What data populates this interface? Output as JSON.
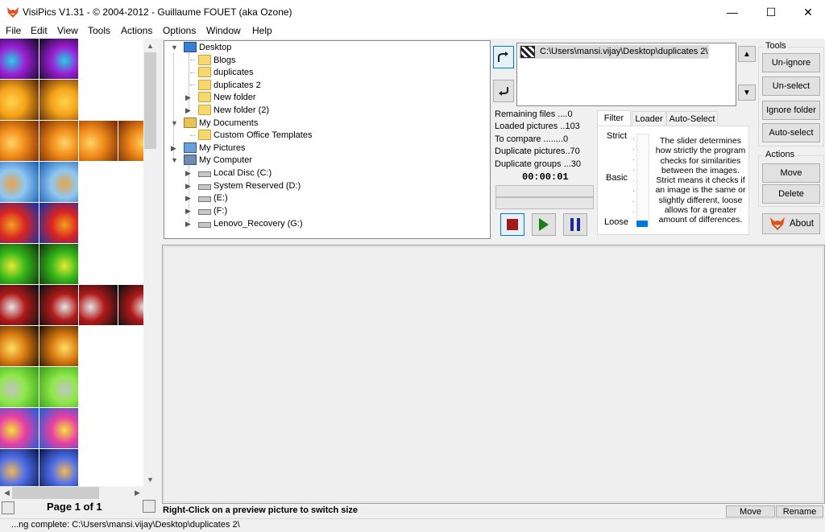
{
  "window": {
    "title": "VisiPics V1.31 - © 2004-2012 - Guillaume FOUET (aka Ozone)",
    "minimize": "—",
    "maximize": "☐",
    "close": "✕"
  },
  "menu": [
    "File",
    "Edit",
    "View",
    "Tools",
    "Actions",
    "Options",
    "Window",
    "Help"
  ],
  "thumbnails": [
    {
      "colors": [
        "#1a0a2e",
        "#9b1fd4",
        "#24d1e6"
      ]
    },
    {
      "colors": [
        "#5a2a08",
        "#f5a21a",
        "#ffd34d"
      ]
    },
    {
      "colors": [
        "#7a2e05",
        "#f08a19",
        "#ffd566"
      ]
    },
    {
      "colors": [
        "#1e63b8",
        "#8fc8f2",
        "#e8a34a"
      ]
    },
    {
      "colors": [
        "#1632a8",
        "#d92323",
        "#f2a11e"
      ]
    },
    {
      "colors": [
        "#0f3a0c",
        "#36b81a",
        "#e9e935"
      ]
    },
    {
      "colors": [
        "#111111",
        "#b01919",
        "#e6e6e6"
      ]
    },
    {
      "colors": [
        "#2a1605",
        "#d97a10",
        "#ffe066"
      ]
    },
    {
      "colors": [
        "#3aa31a",
        "#8ee84a",
        "#c4c4c4"
      ]
    },
    {
      "colors": [
        "#1f5fd9",
        "#e83fa4",
        "#f5e23a"
      ]
    },
    {
      "colors": [
        "#0c1a5a",
        "#4f6ee8",
        "#f0b85a"
      ]
    }
  ],
  "thumb_pager": {
    "label": "Page 1 of 1"
  },
  "tree": {
    "desktop": "Desktop",
    "blogs": "Blogs",
    "duplicates": "duplicates",
    "duplicates2": "duplicates 2",
    "new_folder": "New folder",
    "new_folder2": "New folder (2)",
    "my_documents": "My Documents",
    "custom_office": "Custom Office Templates",
    "my_pictures": "My Pictures",
    "my_computer": "My Computer",
    "disc_c": "Local Disc (C:)",
    "disc_d": "System Reserved (D:)",
    "disc_e": "(E:)",
    "disc_f": "(F:)",
    "disc_g": "Lenovo_Recovery (G:)"
  },
  "folder_list": [
    "C:\\Users\\mansi.vijay\\Desktop\\duplicates 2\\"
  ],
  "stats": {
    "remaining": "Remaining files ....0",
    "loaded": "Loaded pictures ..103",
    "to_compare": "To compare ........0",
    "duplicate_pictures": "Duplicate pictures..70",
    "duplicate_groups": "Duplicate groups ...30",
    "timer": "00:00:01"
  },
  "tabs": {
    "filter": "Filter",
    "loader": "Loader",
    "auto_select": "Auto-Select"
  },
  "filter": {
    "strict": "Strict",
    "basic": "Basic",
    "loose": "Loose",
    "level": "loose",
    "description": "The slider determines how strictly the program checks for similarities between the images. Strict means it checks if an image is the same or slightly different, loose allows for a greater amount of differences."
  },
  "tools": {
    "title": "Tools",
    "unignore": "Un-ignore",
    "unselect": "Un-select",
    "ignore_folder": "Ignore folder",
    "auto_select": "Auto-select"
  },
  "actions": {
    "title": "Actions",
    "move": "Move",
    "delete": "Delete",
    "about": "About"
  },
  "preview": {
    "hint": "Right-Click on a preview picture to switch size",
    "move": "Move",
    "rename": "Rename"
  },
  "status": {
    "text": "...ng complete: C:\\Users\\mansi.vijay\\Desktop\\duplicates 2\\"
  },
  "colors": {
    "accent": "#0078d7",
    "stop": "#a01c1c",
    "play": "#1a7d1a",
    "pause": "#1a2a9a"
  }
}
